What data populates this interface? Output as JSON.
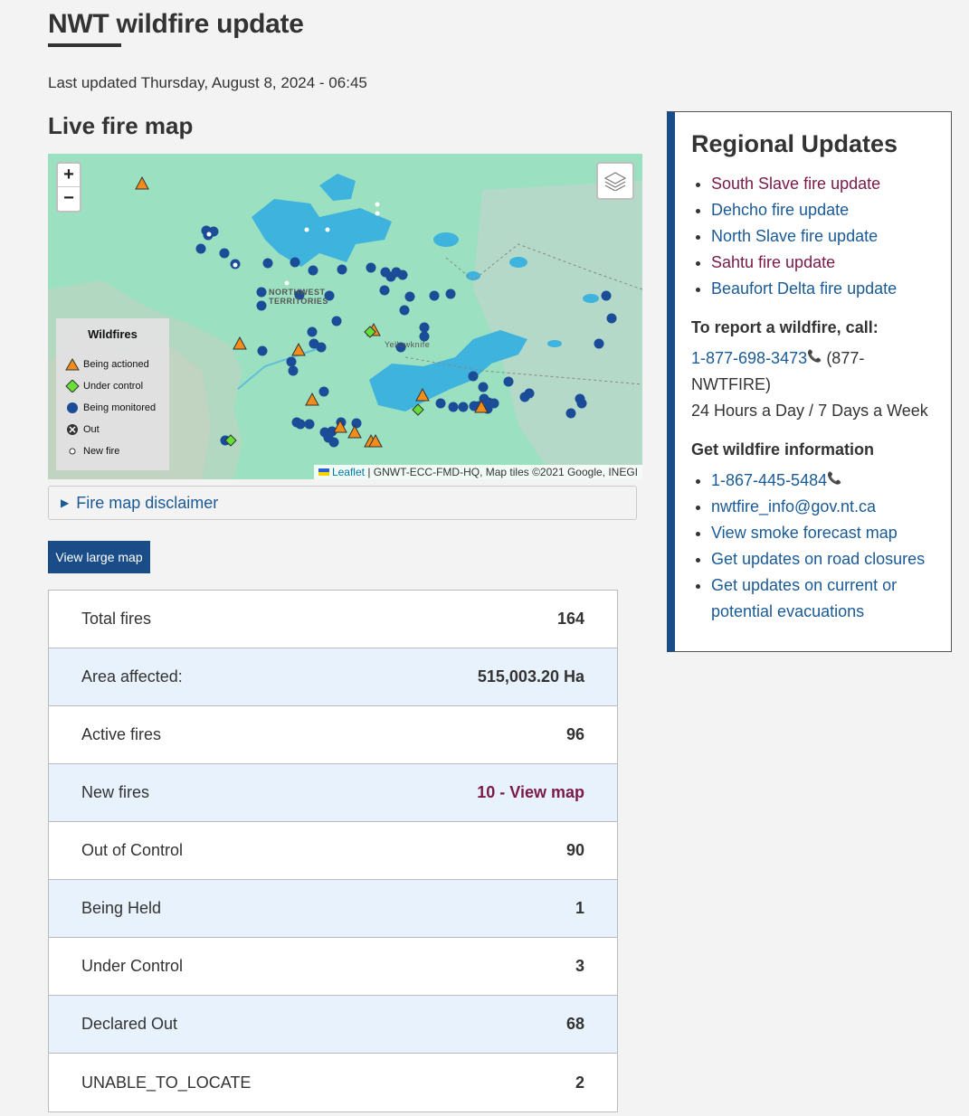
{
  "page": {
    "title": "NWT wildfire update",
    "last_updated": "Last updated Thursday, August 8, 2024 - 06:45",
    "map_section_title": "Live fire map"
  },
  "map": {
    "zoom_in": "+",
    "zoom_out": "−",
    "label_nwt_1": "NORTHWEST",
    "label_nwt_2": "TERRITORIES",
    "label_yellowknife": "Yellowknife",
    "legend": {
      "title": "Wildfires",
      "items": [
        "Being actioned",
        "Under control",
        "Being monitored",
        "Out",
        "New fire"
      ]
    },
    "attribution": {
      "leaflet": "Leaflet",
      "rest": "| GNWT-ECC-FMD-HQ, Map tiles ©2021 Google, INEGI"
    },
    "colors": {
      "land": "#9be0c0",
      "water": "#3db3dd",
      "being_actioned": "#f28c1a",
      "under_control": "#66e035",
      "being_monitored": "#1a4c98"
    }
  },
  "disclaimer": {
    "label": "Fire map disclaimer"
  },
  "view_large_map": "View large map",
  "stats": [
    {
      "label": "Total fires",
      "value": "164"
    },
    {
      "label": "Area affected:",
      "value": "515,003.20 Ha"
    },
    {
      "label": "Active fires",
      "value": "96"
    },
    {
      "label": "New fires",
      "value": "10 - View map"
    },
    {
      "label": "Out of Control",
      "value": "90"
    },
    {
      "label": "Being Held",
      "value": "1"
    },
    {
      "label": "Under Control",
      "value": "3"
    },
    {
      "label": "Declared Out",
      "value": "68"
    },
    {
      "label": "UNABLE_TO_LOCATE",
      "value": "2"
    }
  ],
  "sidebar": {
    "title": "Regional Updates",
    "regions": [
      "South Slave fire update",
      "Dehcho fire update",
      "North Slave fire update",
      "Sahtu fire update",
      "Beaufort Delta fire update"
    ],
    "report_heading": "To report a wildfire, call:",
    "report_phone": "1-877-698-3473",
    "report_alt": "(877-NWTFIRE)",
    "report_hours": "24 Hours a Day / 7 Days a Week",
    "info_heading": "Get wildfire information",
    "info_links": [
      "1-867-445-5484",
      "nwtfire_info@gov.nt.ca",
      "View smoke forecast map",
      "Get updates on road closures",
      "Get updates on current or potential evacuations"
    ]
  }
}
